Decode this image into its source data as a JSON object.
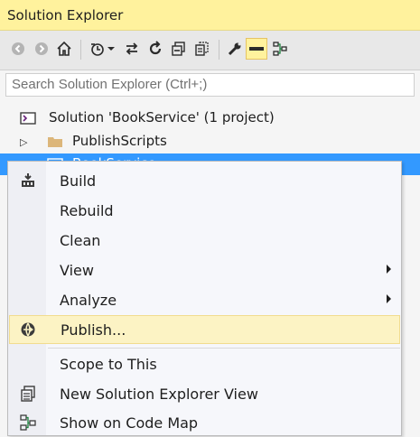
{
  "window": {
    "title": "Solution Explorer"
  },
  "toolbar": {
    "buttons": [
      {
        "name": "back-icon",
        "glyph": "◀"
      },
      {
        "name": "forward-icon",
        "glyph": "▶"
      },
      {
        "name": "home-icon",
        "glyph": "⌂"
      },
      {
        "name": "pending-changes-filter-icon",
        "glyph": "⏲"
      },
      {
        "name": "dropdown-arrow-icon",
        "glyph": "▾"
      },
      {
        "name": "sync-with-active-document-icon",
        "glyph": "⇄"
      },
      {
        "name": "refresh-icon",
        "glyph": "↻"
      },
      {
        "name": "collapse-all-icon",
        "glyph": "⊟"
      },
      {
        "name": "show-all-files-icon",
        "glyph": "⧉"
      },
      {
        "name": "properties-wrench-icon",
        "glyph": "🔧"
      },
      {
        "name": "preview-selected-items-icon",
        "glyph": "▬"
      },
      {
        "name": "code-map-icon",
        "glyph": "⊞"
      }
    ]
  },
  "search": {
    "placeholder": "Search Solution Explorer (Ctrl+;)"
  },
  "tree": {
    "solution": "Solution 'BookService' (1 project)",
    "folder": "PublishScripts",
    "project": "BookService"
  },
  "context_menu": {
    "build": "Build",
    "rebuild": "Rebuild",
    "clean": "Clean",
    "view": "View",
    "analyze": "Analyze",
    "publish": "Publish...",
    "scope": "Scope to This",
    "new_view": "New Solution Explorer View",
    "code_map": "Show on Code Map"
  },
  "colors": {
    "title_bar": "#fff29d",
    "selection": "#3399ff",
    "menu_hover": "#fcf3c4",
    "folder": "#dcb67a"
  }
}
